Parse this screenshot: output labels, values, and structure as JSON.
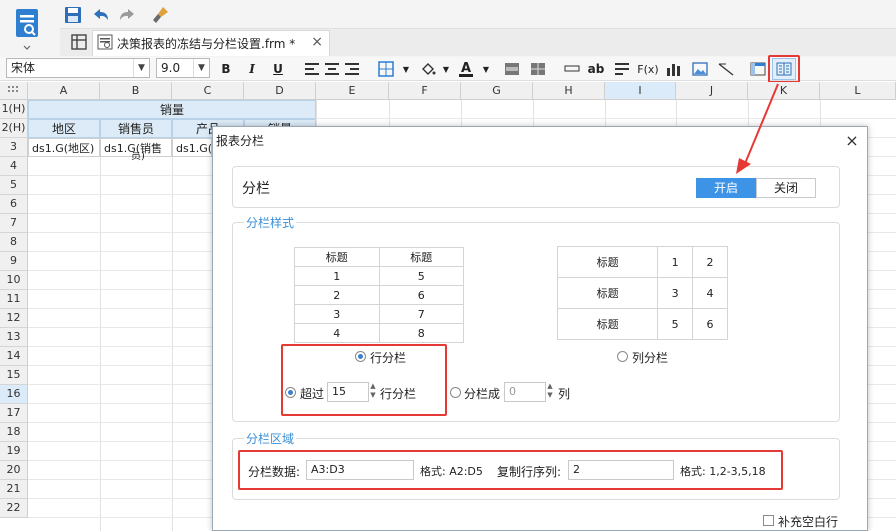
{
  "tab": {
    "title": "决策报表的冻结与分栏设置.frm *"
  },
  "toolbar": {
    "font": "宋体",
    "font_size": "9.0",
    "bold": "B",
    "italic": "I",
    "underline": "U",
    "text_ab": "ab",
    "fx": "F(x)"
  },
  "columns": [
    "A",
    "B",
    "C",
    "D",
    "E",
    "F",
    "G",
    "H",
    "I",
    "J",
    "K",
    "L"
  ],
  "rows": [
    "1(H)",
    "2(H)",
    "3",
    "4",
    "5",
    "6",
    "7",
    "8",
    "9",
    "10",
    "11",
    "12",
    "13",
    "14",
    "15",
    "16",
    "17",
    "18",
    "19",
    "20",
    "21",
    "22"
  ],
  "sheet": {
    "r1_title": "销量",
    "r2": [
      "地区",
      "销售员",
      "产品",
      "销量"
    ],
    "r3": [
      "ds1.G(地区)",
      "ds1.G(销售",
      "ds1.G(",
      "员)"
    ]
  },
  "dialog": {
    "title": "报表分栏",
    "close": "×",
    "split_label": "分栏",
    "on": "开启",
    "off": "关闭",
    "style_section": "分栏样式",
    "row_table": {
      "headers": [
        "标题",
        "标题"
      ],
      "rows": [
        [
          "1",
          "5"
        ],
        [
          "2",
          "6"
        ],
        [
          "3",
          "7"
        ],
        [
          "4",
          "8"
        ]
      ]
    },
    "col_table": {
      "rows": [
        [
          "标题",
          "1",
          "2"
        ],
        [
          "标题",
          "3",
          "4"
        ],
        [
          "标题",
          "5",
          "6"
        ]
      ]
    },
    "row_split": "行分栏",
    "col_split": "列分栏",
    "exceed": "超过",
    "exceed_value": "15",
    "row_split_suffix": "行分栏",
    "split_into": "分栏成",
    "split_into_value": "0",
    "col_suffix": "列",
    "area_section": "分栏区域",
    "data_label": "分栏数据:",
    "data_value": "A3:D3",
    "format1": "格式: A2:D5",
    "repeat_label": "复制行序列:",
    "repeat_value": "2",
    "format2": "格式: 1,2-3,5,18",
    "fill_blank": "补充空白行"
  },
  "colors": {
    "accent": "#3b8fd6",
    "annotation": "#e53935",
    "active_toggle": "#3d94e6"
  }
}
